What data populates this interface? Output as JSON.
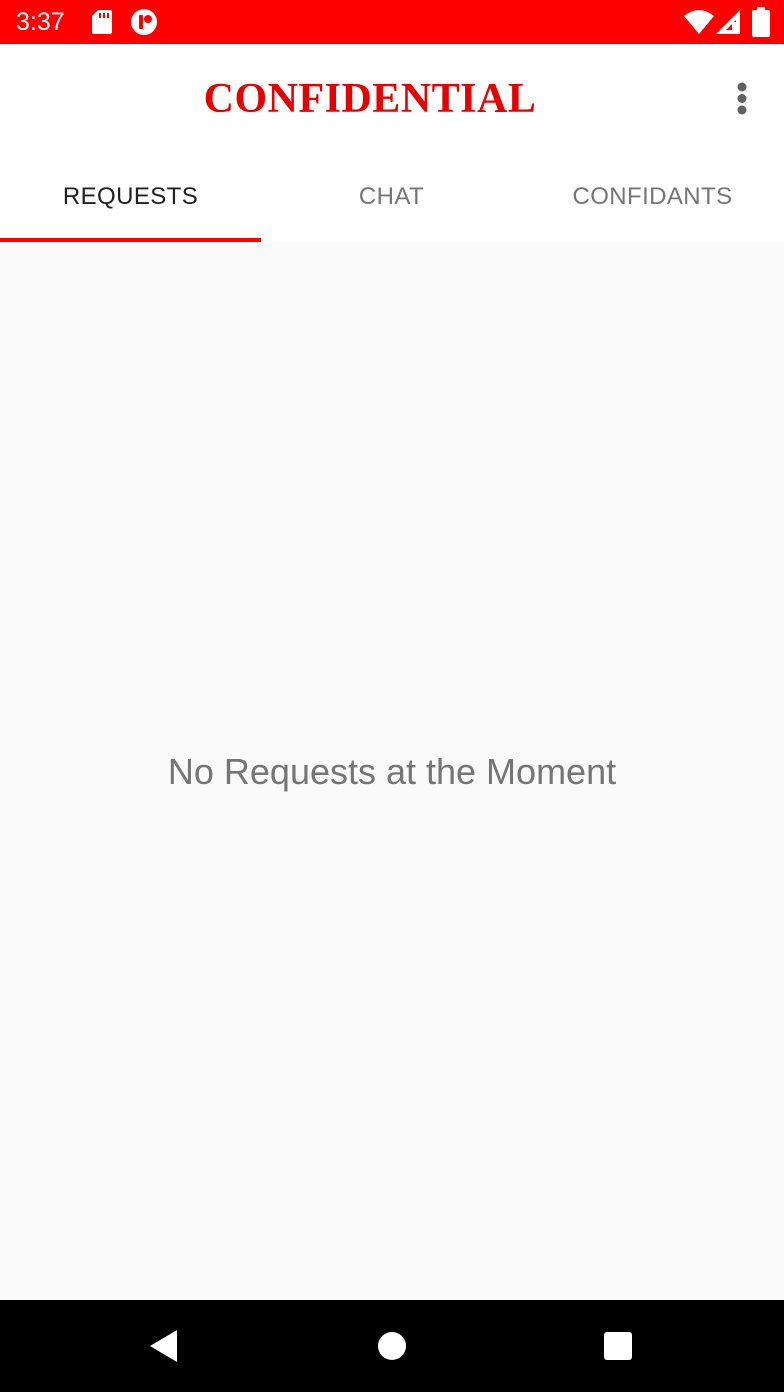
{
  "status_bar": {
    "time": "3:37",
    "color": "#ff0000",
    "icons": [
      "sd-card-icon",
      "notification-app-icon",
      "wifi-icon",
      "cell-signal-icon",
      "battery-icon"
    ]
  },
  "app_bar": {
    "title": "CONFIDENTIAL",
    "title_color": "#e60000",
    "menu_icon": "more-vert-icon"
  },
  "tabs": [
    {
      "label": "REQUESTS",
      "selected": true
    },
    {
      "label": "CHAT",
      "selected": false
    },
    {
      "label": "CONFIDANTS",
      "selected": false
    }
  ],
  "accent_color": "#ff0000",
  "content": {
    "empty_message": "No Requests at the Moment"
  },
  "nav_bar": {
    "buttons": [
      "back-icon",
      "home-icon",
      "recents-icon"
    ]
  }
}
